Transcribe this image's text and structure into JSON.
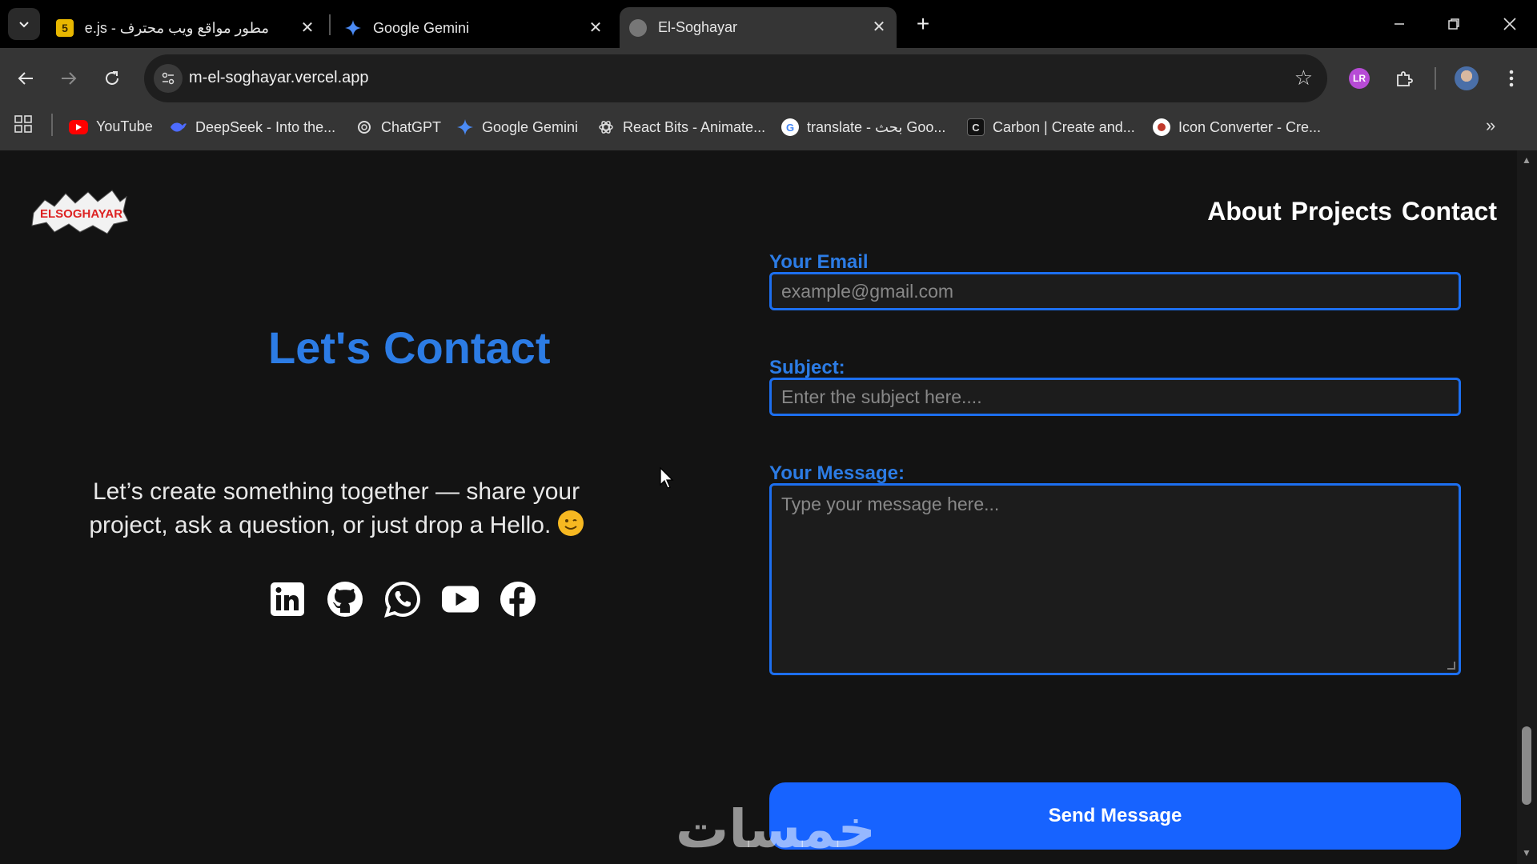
{
  "browser": {
    "tabs": [
      {
        "title": "مطور مواقع ويب محترف - Node.js",
        "favicon": "5",
        "active": false
      },
      {
        "title": "Google Gemini",
        "active": false
      },
      {
        "title": "El-Soghayar",
        "active": true
      }
    ],
    "url": "m-el-soghayar.vercel.app",
    "bookmarks": [
      {
        "label": "YouTube",
        "icon": "youtube-icon"
      },
      {
        "label": "DeepSeek - Into the...",
        "icon": "deepseek-icon"
      },
      {
        "label": "ChatGPT",
        "icon": "chatgpt-icon"
      },
      {
        "label": "Google Gemini",
        "icon": "gemini-icon"
      },
      {
        "label": "React Bits - Animate...",
        "icon": "react-bits-icon"
      },
      {
        "label": "translate - بحث Goo...",
        "icon": "google-icon"
      },
      {
        "label": "Carbon | Create and...",
        "icon": "carbon-icon"
      },
      {
        "label": "Icon Converter - Cre...",
        "icon": "icon-converter-icon"
      }
    ],
    "extension_badge": "LR"
  },
  "site": {
    "logo_text": "ELSOGHAYAR",
    "nav": [
      "About",
      "Projects",
      "Contact"
    ],
    "contact": {
      "title": "Let's Contact",
      "text": "Let’s create something together — share your project, ask a question, or just drop a Hello.",
      "socials": [
        "linkedin-icon",
        "github-icon",
        "whatsapp-icon",
        "youtube-icon",
        "facebook-icon"
      ]
    },
    "form": {
      "email_label": "Your Email",
      "email_placeholder": "example@gmail.com",
      "subject_label": "Subject:",
      "subject_placeholder": "Enter the subject here....",
      "message_label": "Your Message:",
      "message_placeholder": "Type your message here...",
      "submit": "Send Message"
    }
  },
  "watermark": "خمسات",
  "colors": {
    "accent": "#2c7ce5",
    "button": "#1763ff",
    "background": "#131313"
  }
}
